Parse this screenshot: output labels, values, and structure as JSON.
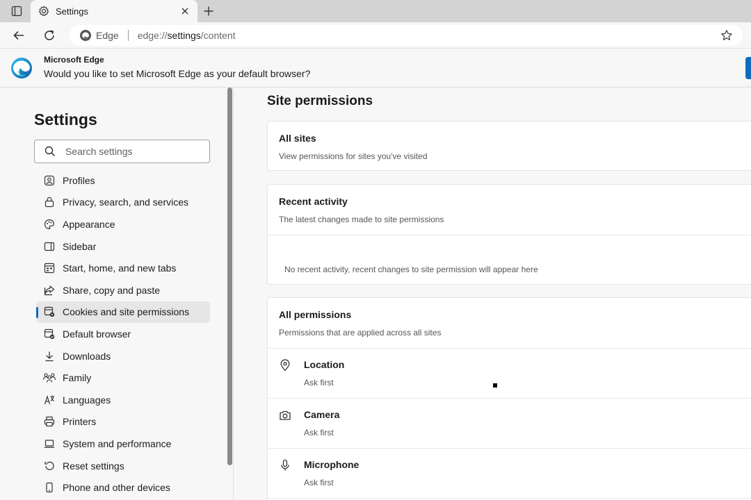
{
  "tab": {
    "title": "Settings"
  },
  "address": {
    "brand": "Edge",
    "scheme": "edge://",
    "host": "settings",
    "path": "/content"
  },
  "infobar": {
    "title": "Microsoft Edge",
    "message": "Would you like to set Microsoft Edge as your default browser?"
  },
  "sidebar": {
    "title": "Settings",
    "search_placeholder": "Search settings",
    "items": [
      {
        "label": "Profiles",
        "icon": "profile-icon"
      },
      {
        "label": "Privacy, search, and services",
        "icon": "lock-icon"
      },
      {
        "label": "Appearance",
        "icon": "palette-icon"
      },
      {
        "label": "Sidebar",
        "icon": "sidebar-icon"
      },
      {
        "label": "Start, home, and new tabs",
        "icon": "home-tab-icon"
      },
      {
        "label": "Share, copy and paste",
        "icon": "share-icon"
      },
      {
        "label": "Cookies and site permissions",
        "icon": "cookie-permissions-icon",
        "active": true
      },
      {
        "label": "Default browser",
        "icon": "default-browser-icon"
      },
      {
        "label": "Downloads",
        "icon": "download-icon"
      },
      {
        "label": "Family",
        "icon": "family-icon"
      },
      {
        "label": "Languages",
        "icon": "language-icon"
      },
      {
        "label": "Printers",
        "icon": "printer-icon"
      },
      {
        "label": "System and performance",
        "icon": "laptop-icon"
      },
      {
        "label": "Reset settings",
        "icon": "reset-icon"
      },
      {
        "label": "Phone and other devices",
        "icon": "phone-icon"
      }
    ]
  },
  "main": {
    "title": "Site permissions",
    "all_sites": {
      "title": "All sites",
      "subtitle": "View permissions for sites you've visited"
    },
    "recent": {
      "title": "Recent activity",
      "subtitle": "The latest changes made to site permissions",
      "empty": "No recent activity, recent changes to site permission will appear here"
    },
    "all_permissions": {
      "title": "All permissions",
      "subtitle": "Permissions that are applied across all sites",
      "items": [
        {
          "name": "Location",
          "value": "Ask first",
          "icon": "location-icon"
        },
        {
          "name": "Camera",
          "value": "Ask first",
          "icon": "camera-icon"
        },
        {
          "name": "Microphone",
          "value": "Ask first",
          "icon": "microphone-icon"
        }
      ]
    }
  },
  "colors": {
    "accent": "#0f6cbd",
    "active_bg": "#e6e6e6"
  }
}
